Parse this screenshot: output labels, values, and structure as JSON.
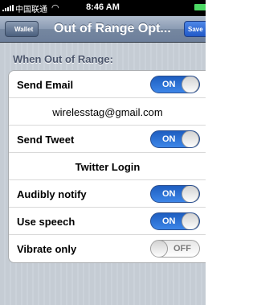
{
  "status_bar": {
    "carrier": "中国联通",
    "time": "8:46 AM",
    "icons": [
      "signal-bars-icon",
      "wifi-icon",
      "battery-icon"
    ]
  },
  "nav": {
    "back_label": "Wallet",
    "title": "Out of Range Opt...",
    "save_label": "Save"
  },
  "section": {
    "header": "When Out of Range:"
  },
  "rows": [
    {
      "label": "Send Email",
      "state": "ON"
    },
    {
      "value": "wirelesstag@gmail.com"
    },
    {
      "label": "Send Tweet",
      "state": "ON"
    },
    {
      "button": "Twitter Login"
    },
    {
      "label": "Audibly notify",
      "state": "ON"
    },
    {
      "label": "Use speech",
      "state": "ON"
    },
    {
      "label": "Vibrate only",
      "state": "OFF"
    }
  ],
  "colors": {
    "toggle_on": "#2a6fd6",
    "navbar": "#7a8ca6",
    "save_button": "#2f69d6",
    "background": "#c5ccd4"
  }
}
